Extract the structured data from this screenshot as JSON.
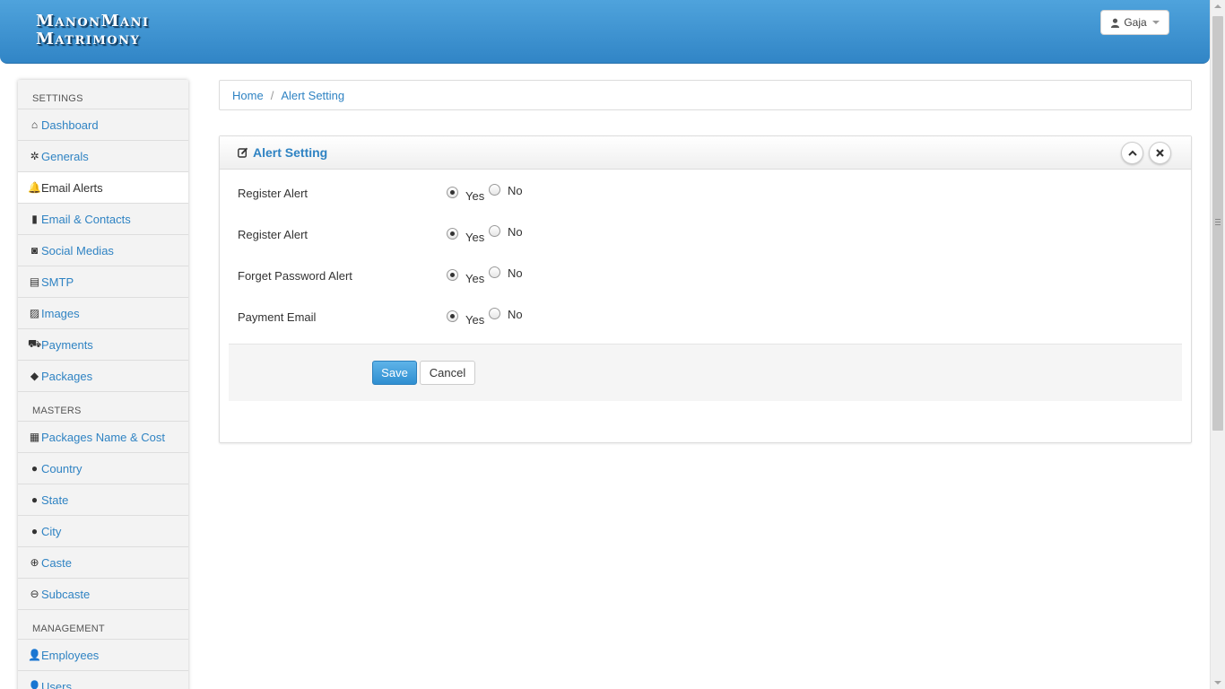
{
  "brand": {
    "line1": "ManonMani",
    "line2": "Matrimony"
  },
  "user_menu": {
    "name": "Gaja"
  },
  "sidebar": {
    "sections": [
      {
        "header": "SETTINGS",
        "items": [
          {
            "label": "Dashboard",
            "icon": "home-icon",
            "glyph": "⌂"
          },
          {
            "label": "Generals",
            "icon": "gear-icon",
            "glyph": "✲"
          },
          {
            "label": "Email Alerts",
            "icon": "bell-icon",
            "glyph": "🔔",
            "active": true
          },
          {
            "label": "Email & Contacts",
            "icon": "book-icon",
            "glyph": "▮"
          },
          {
            "label": "Social Medias",
            "icon": "camera-icon",
            "glyph": "◙"
          },
          {
            "label": "SMTP",
            "icon": "server-icon",
            "glyph": "▤"
          },
          {
            "label": "Images",
            "icon": "picture-icon",
            "glyph": "▨"
          },
          {
            "label": "Payments",
            "icon": "cart-icon",
            "glyph": "⛟"
          },
          {
            "label": "Packages",
            "icon": "tag-icon",
            "glyph": "◆"
          }
        ]
      },
      {
        "header": "MASTERS",
        "items": [
          {
            "label": "Packages Name & Cost",
            "icon": "gift-icon",
            "glyph": "▦"
          },
          {
            "label": "Country",
            "icon": "map-marker-icon",
            "glyph": "●"
          },
          {
            "label": "State",
            "icon": "map-marker-icon",
            "glyph": "●"
          },
          {
            "label": "City",
            "icon": "map-marker-icon",
            "glyph": "●"
          },
          {
            "label": "Caste",
            "icon": "circle-arrow-up-icon",
            "glyph": "⊕"
          },
          {
            "label": "Subcaste",
            "icon": "circle-arrow-down-icon",
            "glyph": "⊖"
          }
        ]
      },
      {
        "header": "MANAGEMENT",
        "items": [
          {
            "label": "Employees",
            "icon": "user-icon",
            "glyph": "👤"
          },
          {
            "label": "Users",
            "icon": "user-icon",
            "glyph": "👤"
          }
        ]
      }
    ]
  },
  "breadcrumb": {
    "home": "Home",
    "separator": "/",
    "current": "Alert Setting"
  },
  "panel": {
    "title": "Alert Setting",
    "rows": [
      {
        "label": "Register Alert",
        "selected": "Yes"
      },
      {
        "label": "Register Alert",
        "selected": "Yes"
      },
      {
        "label": "Forget Password Alert",
        "selected": "Yes"
      },
      {
        "label": "Payment Email",
        "selected": "Yes"
      }
    ],
    "yes_label": "Yes",
    "no_label": "No",
    "save_label": "Save",
    "cancel_label": "Cancel"
  },
  "colors": {
    "header_blue": "#3f95d3",
    "link_blue": "#2f83c3",
    "save_blue": "#3b97d8"
  }
}
